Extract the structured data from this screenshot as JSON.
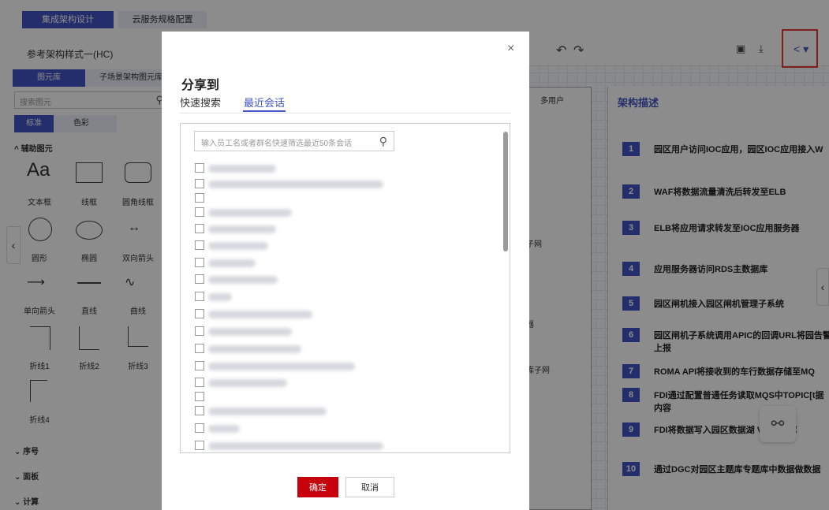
{
  "top_tabs": [
    "集成架构设计",
    "云服务规格配置"
  ],
  "left_panel": {
    "title": "参考架构样式一(HC)",
    "subtabs": [
      "图元库",
      "子场景架构图元库"
    ],
    "search_placeholder": "搜索图元",
    "segments": [
      "标准",
      "色彩"
    ],
    "section_helper": "辅助图元",
    "shapes": [
      "文本框",
      "线框",
      "圆角线框",
      "圆形",
      "椭圆",
      "双向箭头",
      "单向箭头",
      "直线",
      "曲线",
      "折线1",
      "折线2",
      "折线3",
      "折线4"
    ],
    "sections_collapsed": [
      "序号",
      "面板",
      "计算"
    ]
  },
  "canvas": {
    "left_labels": [
      "多用户",
      "子网",
      "器",
      "库子网"
    ]
  },
  "arch": {
    "title": "架构描述",
    "items": [
      {
        "num": "1",
        "text": "园区用户访问IOC应用，园区IOC应用接入W"
      },
      {
        "num": "2",
        "text": "WAF将数据流量清洗后转发至ELB"
      },
      {
        "num": "3",
        "text": "ELB将应用请求转发至IOC应用服务器"
      },
      {
        "num": "4",
        "text": "应用服务器访问RDS主数据库"
      },
      {
        "num": "5",
        "text": "园区闸机接入园区闸机管理子系统"
      },
      {
        "num": "6",
        "text": "园区闸机子系统调用APIC的回调URL将园告警上报"
      },
      {
        "num": "7",
        "text": "ROMA API将接收到的车行数据存储至MQ"
      },
      {
        "num": "8",
        "text": "FDI通过配置普通任务读取MQS中TOPIC[t据内容"
      },
      {
        "num": "9",
        "text": "FDI将数据写入园区数据湖 VE 主题库"
      },
      {
        "num": "10",
        "text": "通过DGC对园区主题库专题库中数据做数据"
      }
    ]
  },
  "modal": {
    "title": "分享到",
    "close": "×",
    "tabs": [
      "快速搜索",
      "最近会话"
    ],
    "active_tab": "最近会话",
    "search_placeholder": "输入员工名或者群名快速筛选最近50条会话",
    "confirm": "确定",
    "cancel": "取消"
  },
  "colors": {
    "accent": "#4254c6",
    "confirm": "#c7000b",
    "highlight": "#e53935"
  }
}
